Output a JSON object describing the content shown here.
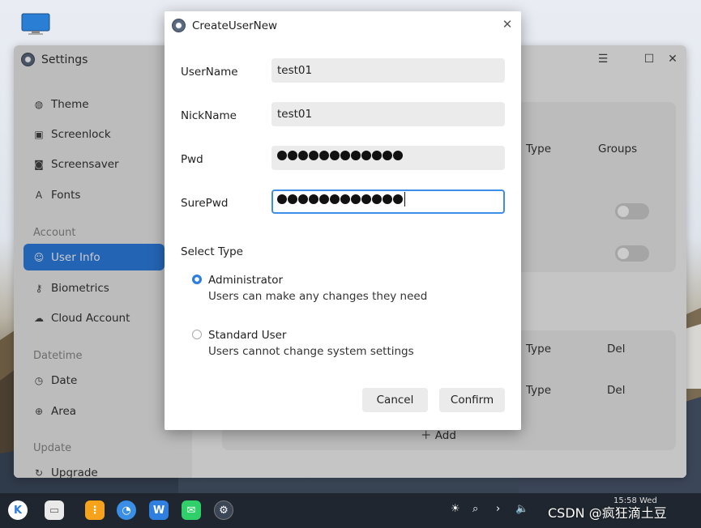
{
  "settings": {
    "title": "Settings",
    "window_controls": {
      "menu": "☰",
      "maximize": "☐",
      "close": "✕"
    },
    "sidebar": {
      "items_top": [
        {
          "label": "Theme",
          "icon": "palette-icon"
        },
        {
          "label": "Screenlock",
          "icon": "screenlock-icon"
        },
        {
          "label": "Screensaver",
          "icon": "screensaver-icon"
        },
        {
          "label": "Fonts",
          "icon": "fonts-icon"
        }
      ],
      "group_account": "Account",
      "items_account": [
        {
          "label": "User Info",
          "icon": "user-icon",
          "active": true
        },
        {
          "label": "Biometrics",
          "icon": "key-icon"
        },
        {
          "label": "Cloud Account",
          "icon": "cloud-icon"
        }
      ],
      "group_datetime": "Datetime",
      "items_datetime": [
        {
          "label": "Date",
          "icon": "clock-icon"
        },
        {
          "label": "Area",
          "icon": "globe-icon"
        }
      ],
      "group_update": "Update",
      "items_update": [
        {
          "label": "Upgrade",
          "icon": "upgrade-icon"
        }
      ]
    },
    "main": {
      "table1": {
        "type_header": "Type",
        "groups_header": "Groups"
      },
      "table2": {
        "type_header": "Type",
        "del_header": "Del",
        "row_type": "Type",
        "row_del": "Del"
      },
      "add_label": "Add"
    }
  },
  "dialog": {
    "title": "CreateUserNew",
    "close": "✕",
    "username": {
      "label": "UserName",
      "value": "test01"
    },
    "nickname": {
      "label": "NickName",
      "value": "test01"
    },
    "pwd": {
      "label": "Pwd",
      "masked_count": 12
    },
    "surepwd": {
      "label": "SurePwd",
      "masked_count": 12
    },
    "select_type_label": "Select Type",
    "options": [
      {
        "title": "Administrator",
        "desc": "Users can make any changes they need",
        "checked": true
      },
      {
        "title": "Standard User",
        "desc": "Users cannot change system settings",
        "checked": false
      }
    ],
    "cancel_label": "Cancel",
    "confirm_label": "Confirm"
  },
  "taskbar": {
    "time": "15:58 Wed",
    "watermark": "CSDN @疯狂滴土豆",
    "apps": [
      "start-menu-icon",
      "file-manager-icon",
      "app-store-icon",
      "browser-icon",
      "wps-icon",
      "chat-icon",
      "settings-icon"
    ]
  }
}
